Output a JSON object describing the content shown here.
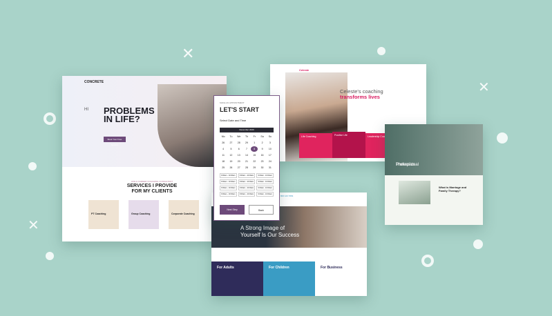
{
  "palette": {
    "background": "#a9d3c9",
    "purple": "#6d4a7a",
    "pink": "#d81b60",
    "blue": "#3a9cc4",
    "navy": "#2f2c5a"
  },
  "decorations": [
    "cross-icon",
    "ring-icon",
    "dot-icon"
  ],
  "concrete": {
    "logo": "CONCRETE",
    "hi": "HI",
    "title_1": "PROBLEMS",
    "title_2": "IN LIFE?",
    "cta": "Book Your Free Session",
    "services_subtitle": "LIFE & CAREER COACHING CONSULTANT",
    "services_title_1": "SERVICES I PROVIDE",
    "services_title_2": "FOR MY CLIENTS",
    "services": [
      {
        "label": "PT Coaching"
      },
      {
        "label": "Group Coaching"
      },
      {
        "label": "Corporate Coaching"
      }
    ]
  },
  "appointment": {
    "lead": "MAKE AN APPOINTMENT",
    "title": "LET'S START",
    "subtitle": "Select Date and Time",
    "month": "December 2020",
    "weekdays": [
      "Mo",
      "Tu",
      "We",
      "Th",
      "Fr",
      "Sa",
      "Su"
    ],
    "days": [
      "26",
      "27",
      "28",
      "29",
      "1",
      "2",
      "3",
      "4",
      "5",
      "6",
      "7",
      "8",
      "9",
      "10",
      "11",
      "12",
      "13",
      "14",
      "15",
      "16",
      "17",
      "18",
      "19",
      "20",
      "21",
      "22",
      "23",
      "24",
      "25",
      "26",
      "27",
      "28",
      "29",
      "30",
      "31"
    ],
    "selected_day": "8",
    "slots": [
      "9:00am - 10:00am",
      "9:00am - 10:00am",
      "9:00am - 10:00am",
      "9:00am - 10:00am",
      "9:00am - 10:00am",
      "9:00am - 10:00am",
      "9:00am - 10:00am",
      "9:00am - 10:00am",
      "9:00am - 10:00am",
      "9:00am - 10:00am",
      "9:00am - 10:00am",
      "9:00am - 10:00am"
    ],
    "next_label": "Next Step",
    "back_label": "Back"
  },
  "celeste": {
    "brand": "Celeste",
    "headline_1": "Celeste's coaching",
    "headline_2": "transforms lives",
    "tiles": [
      "Life Coaching",
      "Positive Life",
      "Leadership Coaching"
    ]
  },
  "therapy": {
    "hero_1": "Professional",
    "hero_2": "Therapists",
    "question_1": "What is Marriage and",
    "question_2": "Family Therapy?"
  },
  "strong": {
    "phone": "800 123 7654",
    "headline_1": "A Strong Image of",
    "headline_2": "Yourself Is Our Success",
    "columns": [
      {
        "title": "For Adults"
      },
      {
        "title": "For Children"
      },
      {
        "title": "For Business"
      }
    ]
  }
}
